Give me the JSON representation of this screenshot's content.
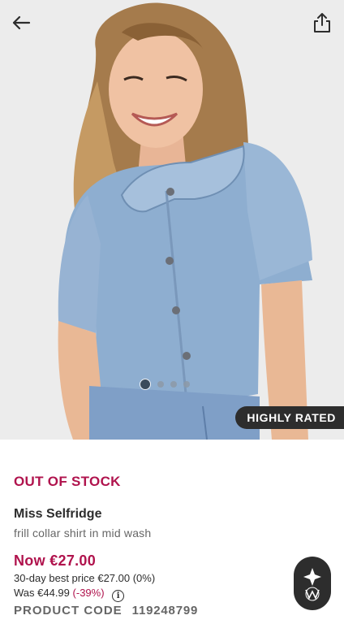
{
  "header": {
    "back_icon": "arrow-left-icon",
    "share_icon": "share-icon"
  },
  "gallery": {
    "image_description_icon": "product-photo",
    "image_count": 4,
    "active_index": 0,
    "badge": "HIGHLY RATED"
  },
  "product": {
    "stock_status": "OUT OF STOCK",
    "brand": "Miss Selfridge",
    "name": "frill collar shirt in mid wash",
    "price_now": "Now €27.00",
    "best_price_text": "30-day best price €27.00 (0%)",
    "was_price": "Was €44.99",
    "discount": "(-39%)",
    "info_icon": "info-circle-icon",
    "code_label": "PRODUCT CODE",
    "code_value": "119248799"
  },
  "fab": {
    "icon": "style-match-icon"
  },
  "colors": {
    "accent": "#b0134d",
    "text": "#2d2d2d",
    "muted": "#666666",
    "denim": "#8eaed0"
  }
}
